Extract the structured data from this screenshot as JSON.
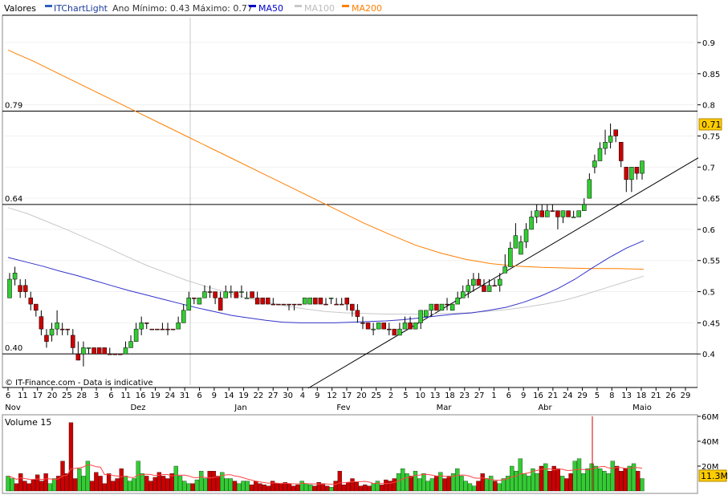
{
  "header": {
    "title": "Valores",
    "ticker": "ITChartLight",
    "range_text": "Ano Mínimo: 0.43 Máximo: 0.77",
    "legend": [
      {
        "label": "MA50",
        "color": "#0000cc"
      },
      {
        "label": "MA100",
        "color": "#c8c8c8"
      },
      {
        "label": "MA200",
        "color": "#ff7f00"
      }
    ]
  },
  "watermark": "© IT-Finance.com - Data is indicative",
  "levels": [
    {
      "value": 0.79,
      "label": "0.79"
    },
    {
      "value": 0.64,
      "label": "0.64"
    },
    {
      "value": 0.4,
      "label": "0.40"
    }
  ],
  "last_price": {
    "label": "0.71",
    "color": "#ffcc00"
  },
  "volume_panel": {
    "title": "Volume 15",
    "last_label": "11.3M",
    "ylim": [
      0,
      60
    ],
    "yticks": [
      {
        "value": 20,
        "label": "20M"
      },
      {
        "value": 40,
        "label": "40M"
      },
      {
        "value": 60,
        "label": "60M"
      }
    ]
  },
  "chart_data": {
    "type": "candlestick",
    "ylim": [
      0.35,
      0.94
    ],
    "yticks": [
      "0.4",
      "0.45",
      "0.5",
      "0.55",
      "0.6",
      "0.65",
      "0.7",
      "0.75",
      "0.8",
      "0.85",
      "0.9"
    ],
    "ytick_values": [
      0.4,
      0.45,
      0.5,
      0.55,
      0.6,
      0.65,
      0.7,
      0.75,
      0.8,
      0.85,
      0.9
    ],
    "xticks": [
      "6",
      "11",
      "17",
      "20",
      "25",
      "28",
      "3",
      "6",
      "11",
      "16",
      "19",
      "24",
      "31",
      "6",
      "9",
      "14",
      "19",
      "22",
      "27",
      "30",
      "4",
      "9",
      "12",
      "17",
      "20",
      "25",
      "2",
      "5",
      "10",
      "13",
      "18",
      "23",
      "27",
      "1",
      "6",
      "9",
      "16",
      "21",
      "24",
      "29",
      "5",
      "8",
      "13",
      "18",
      "21",
      "26",
      "29"
    ],
    "months": [
      "Nov",
      "Dez",
      "Jan",
      "Fev",
      "Mar",
      "Abr",
      "Maio"
    ],
    "candles": [
      [
        0.49,
        0.52,
        0.53,
        0.49,
        "up"
      ],
      [
        0.52,
        0.53,
        0.54,
        0.51,
        "up"
      ],
      [
        0.51,
        0.5,
        0.52,
        0.49,
        "down"
      ],
      [
        0.51,
        0.5,
        0.52,
        0.49,
        "down"
      ],
      [
        0.49,
        0.48,
        0.5,
        0.47,
        "down"
      ],
      [
        0.48,
        0.47,
        0.48,
        0.46,
        "down"
      ],
      [
        0.46,
        0.44,
        0.47,
        0.43,
        "down"
      ],
      [
        0.43,
        0.42,
        0.44,
        0.41,
        "down"
      ],
      [
        0.43,
        0.44,
        0.45,
        0.42,
        "up"
      ],
      [
        0.44,
        0.45,
        0.47,
        0.43,
        "up"
      ],
      [
        0.44,
        0.44,
        0.45,
        0.43,
        "down"
      ],
      [
        0.44,
        0.44,
        0.44,
        0.43,
        "down"
      ],
      [
        0.43,
        0.41,
        0.44,
        0.4,
        "down"
      ],
      [
        0.4,
        0.39,
        0.42,
        0.39,
        "down"
      ],
      [
        0.4,
        0.41,
        0.42,
        0.38,
        "up"
      ],
      [
        0.41,
        0.41,
        0.41,
        0.4,
        "up"
      ],
      [
        0.41,
        0.4,
        0.41,
        0.4,
        "down"
      ],
      [
        0.41,
        0.4,
        0.41,
        0.4,
        "down"
      ],
      [
        0.41,
        0.4,
        0.41,
        0.4,
        "down"
      ],
      [
        0.4,
        0.4,
        0.41,
        0.4,
        "down"
      ],
      [
        0.4,
        0.4,
        0.4,
        0.4,
        "down"
      ],
      [
        0.4,
        0.4,
        0.4,
        0.4,
        "down"
      ],
      [
        0.4,
        0.41,
        0.42,
        0.4,
        "up"
      ],
      [
        0.41,
        0.42,
        0.43,
        0.41,
        "up"
      ],
      [
        0.42,
        0.44,
        0.45,
        0.42,
        "up"
      ],
      [
        0.44,
        0.45,
        0.46,
        0.43,
        "up"
      ],
      [
        0.45,
        0.45,
        0.45,
        0.44,
        "down"
      ],
      [
        0.44,
        0.44,
        0.44,
        0.44,
        "down"
      ],
      [
        0.44,
        0.44,
        0.44,
        0.44,
        "down"
      ],
      [
        0.44,
        0.44,
        0.45,
        0.44,
        "down"
      ],
      [
        0.44,
        0.44,
        0.45,
        0.43,
        "down"
      ],
      [
        0.44,
        0.44,
        0.44,
        0.44,
        "down"
      ],
      [
        0.44,
        0.45,
        0.46,
        0.44,
        "up"
      ],
      [
        0.45,
        0.47,
        0.48,
        0.45,
        "up"
      ],
      [
        0.47,
        0.49,
        0.5,
        0.47,
        "up"
      ],
      [
        0.49,
        0.49,
        0.49,
        0.48,
        "down"
      ],
      [
        0.48,
        0.49,
        0.49,
        0.48,
        "up"
      ],
      [
        0.49,
        0.5,
        0.51,
        0.49,
        "up"
      ],
      [
        0.5,
        0.5,
        0.51,
        0.49,
        "down"
      ],
      [
        0.5,
        0.49,
        0.5,
        0.48,
        "down"
      ],
      [
        0.49,
        0.47,
        0.5,
        0.47,
        "down"
      ],
      [
        0.49,
        0.5,
        0.51,
        0.49,
        "up"
      ],
      [
        0.5,
        0.5,
        0.51,
        0.49,
        "up"
      ],
      [
        0.5,
        0.49,
        0.5,
        0.49,
        "down"
      ],
      [
        0.5,
        0.5,
        0.51,
        0.49,
        "up"
      ],
      [
        0.49,
        0.49,
        0.5,
        0.49,
        "up"
      ],
      [
        0.5,
        0.49,
        0.5,
        0.49,
        "down"
      ],
      [
        0.49,
        0.48,
        0.5,
        0.48,
        "down"
      ],
      [
        0.49,
        0.48,
        0.49,
        0.48,
        "down"
      ],
      [
        0.49,
        0.48,
        0.49,
        0.48,
        "down"
      ],
      [
        0.48,
        0.48,
        0.49,
        0.48,
        "down"
      ],
      [
        0.48,
        0.48,
        0.48,
        0.48,
        "down"
      ],
      [
        0.48,
        0.48,
        0.48,
        0.48,
        "down"
      ],
      [
        0.48,
        0.48,
        0.48,
        0.47,
        "down"
      ],
      [
        0.48,
        0.48,
        0.48,
        0.47,
        "down"
      ],
      [
        0.48,
        0.48,
        0.48,
        0.48,
        "down"
      ],
      [
        0.48,
        0.49,
        0.49,
        0.48,
        "up"
      ],
      [
        0.48,
        0.49,
        0.49,
        0.48,
        "up"
      ],
      [
        0.49,
        0.48,
        0.49,
        0.48,
        "down"
      ],
      [
        0.49,
        0.48,
        0.49,
        0.48,
        "down"
      ],
      [
        0.48,
        0.48,
        0.49,
        0.48,
        "down"
      ],
      [
        0.49,
        0.49,
        0.49,
        0.48,
        "up"
      ],
      [
        0.48,
        0.48,
        0.49,
        0.48,
        "down"
      ],
      [
        0.48,
        0.48,
        0.49,
        0.48,
        "down"
      ],
      [
        0.49,
        0.48,
        0.49,
        0.47,
        "down"
      ],
      [
        0.48,
        0.47,
        0.48,
        0.46,
        "down"
      ],
      [
        0.47,
        0.46,
        0.48,
        0.45,
        "down"
      ],
      [
        0.45,
        0.45,
        0.46,
        0.44,
        "down"
      ],
      [
        0.45,
        0.44,
        0.45,
        0.44,
        "down"
      ],
      [
        0.44,
        0.44,
        0.45,
        0.43,
        "up"
      ],
      [
        0.44,
        0.45,
        0.45,
        0.44,
        "up"
      ],
      [
        0.45,
        0.44,
        0.45,
        0.44,
        "down"
      ],
      [
        0.44,
        0.44,
        0.45,
        0.43,
        "down"
      ],
      [
        0.44,
        0.43,
        0.44,
        0.43,
        "down"
      ],
      [
        0.43,
        0.44,
        0.45,
        0.43,
        "up"
      ],
      [
        0.44,
        0.45,
        0.46,
        0.44,
        "up"
      ],
      [
        0.45,
        0.44,
        0.46,
        0.44,
        "down"
      ],
      [
        0.44,
        0.45,
        0.45,
        0.44,
        "up"
      ],
      [
        0.45,
        0.47,
        0.47,
        0.44,
        "up"
      ],
      [
        0.46,
        0.47,
        0.47,
        0.46,
        "up"
      ],
      [
        0.47,
        0.48,
        0.48,
        0.46,
        "up"
      ],
      [
        0.48,
        0.47,
        0.48,
        0.47,
        "down"
      ],
      [
        0.47,
        0.48,
        0.48,
        0.47,
        "up"
      ],
      [
        0.48,
        0.48,
        0.49,
        0.47,
        "down"
      ],
      [
        0.47,
        0.48,
        0.48,
        0.47,
        "up"
      ],
      [
        0.48,
        0.49,
        0.5,
        0.48,
        "up"
      ],
      [
        0.49,
        0.5,
        0.51,
        0.49,
        "up"
      ],
      [
        0.5,
        0.51,
        0.52,
        0.49,
        "up"
      ],
      [
        0.51,
        0.52,
        0.53,
        0.5,
        "up"
      ],
      [
        0.52,
        0.51,
        0.53,
        0.51,
        "down"
      ],
      [
        0.51,
        0.5,
        0.52,
        0.5,
        "down"
      ],
      [
        0.5,
        0.51,
        0.52,
        0.5,
        "up"
      ],
      [
        0.51,
        0.51,
        0.52,
        0.51,
        "down"
      ],
      [
        0.51,
        0.52,
        0.53,
        0.5,
        "up"
      ],
      [
        0.53,
        0.54,
        0.56,
        0.53,
        "up"
      ],
      [
        0.54,
        0.57,
        0.58,
        0.54,
        "up"
      ],
      [
        0.57,
        0.59,
        0.61,
        0.57,
        "up"
      ],
      [
        0.56,
        0.58,
        0.59,
        0.56,
        "up"
      ],
      [
        0.58,
        0.6,
        0.61,
        0.57,
        "up"
      ],
      [
        0.6,
        0.62,
        0.63,
        0.6,
        "up"
      ],
      [
        0.62,
        0.63,
        0.64,
        0.61,
        "up"
      ],
      [
        0.63,
        0.62,
        0.64,
        0.62,
        "down"
      ],
      [
        0.62,
        0.63,
        0.64,
        0.62,
        "up"
      ],
      [
        0.63,
        0.63,
        0.64,
        0.63,
        "down"
      ],
      [
        0.63,
        0.62,
        0.63,
        0.6,
        "down"
      ],
      [
        0.62,
        0.63,
        0.63,
        0.61,
        "up"
      ],
      [
        0.63,
        0.62,
        0.63,
        0.62,
        "down"
      ],
      [
        0.62,
        0.62,
        0.63,
        0.62,
        "up"
      ],
      [
        0.62,
        0.63,
        0.63,
        0.62,
        "up"
      ],
      [
        0.63,
        0.64,
        0.65,
        0.63,
        "up"
      ],
      [
        0.65,
        0.68,
        0.69,
        0.65,
        "up"
      ],
      [
        0.7,
        0.71,
        0.72,
        0.69,
        "up"
      ],
      [
        0.71,
        0.73,
        0.74,
        0.71,
        "up"
      ],
      [
        0.73,
        0.74,
        0.76,
        0.72,
        "up"
      ],
      [
        0.74,
        0.75,
        0.77,
        0.73,
        "up"
      ],
      [
        0.76,
        0.75,
        0.76,
        0.74,
        "down"
      ],
      [
        0.74,
        0.71,
        0.74,
        0.7,
        "down"
      ],
      [
        0.7,
        0.68,
        0.7,
        0.66,
        "down"
      ],
      [
        0.68,
        0.7,
        0.7,
        0.66,
        "up"
      ],
      [
        0.7,
        0.69,
        0.7,
        0.68,
        "down"
      ],
      [
        0.69,
        0.71,
        0.71,
        0.68,
        "up"
      ]
    ],
    "ma50": [
      0.555,
      0.548,
      0.541,
      0.533,
      0.526,
      0.518,
      0.51,
      0.502,
      0.495,
      0.488,
      0.481,
      0.474,
      0.468,
      0.462,
      0.458,
      0.454,
      0.451,
      0.45,
      0.45,
      0.45,
      0.451,
      0.452,
      0.453,
      0.455,
      0.458,
      0.461,
      0.464,
      0.466,
      0.47,
      0.475,
      0.483,
      0.493,
      0.505,
      0.52,
      0.538,
      0.555,
      0.57,
      0.582
    ],
    "ma100": [
      0.635,
      0.625,
      0.612,
      0.599,
      0.585,
      0.571,
      0.556,
      0.542,
      0.53,
      0.518,
      0.508,
      0.499,
      0.49,
      0.483,
      0.477,
      0.472,
      0.468,
      0.466,
      0.465,
      0.464,
      0.464,
      0.464,
      0.465,
      0.466,
      0.468,
      0.471,
      0.475,
      0.48,
      0.486,
      0.495,
      0.505,
      0.515,
      0.525
    ],
    "ma200": [
      0.888,
      0.87,
      0.85,
      0.83,
      0.81,
      0.79,
      0.77,
      0.75,
      0.73,
      0.71,
      0.69,
      0.67,
      0.65,
      0.63,
      0.61,
      0.592,
      0.575,
      0.562,
      0.552,
      0.545,
      0.541,
      0.539,
      0.538,
      0.537,
      0.537,
      0.536
    ],
    "trendline": [
      [
        0.345,
        384
      ],
      [
        0.715,
        870
      ]
    ],
    "volume_panel_series": {
      "name": "Volume 15",
      "values": [
        12,
        10,
        6,
        14,
        8,
        6,
        9,
        13,
        8,
        14,
        6,
        10,
        12,
        24,
        14,
        55,
        10,
        18,
        12,
        24,
        8,
        15,
        12,
        6,
        14,
        8,
        10,
        18,
        12,
        8,
        10,
        24,
        14,
        12,
        8,
        11,
        15,
        12,
        10,
        14,
        20,
        12,
        8,
        6,
        6,
        9,
        16,
        10,
        16,
        16,
        12,
        15,
        10,
        10,
        8,
        6,
        8,
        8,
        5,
        8,
        6,
        5,
        4,
        8,
        6,
        6,
        7,
        6,
        4,
        5,
        8,
        6,
        5,
        4,
        7,
        6,
        4,
        3,
        8,
        16,
        5,
        7,
        10,
        7,
        4,
        5,
        4,
        6,
        8,
        5,
        9,
        8,
        10,
        14,
        18,
        14,
        12,
        16,
        10,
        14,
        8,
        10,
        12,
        15,
        10,
        12,
        14,
        18,
        12,
        8,
        6,
        4,
        8,
        14,
        10,
        12,
        8,
        6,
        10,
        12,
        20,
        16,
        26,
        14,
        12,
        18,
        14,
        20,
        22,
        16,
        20,
        18,
        12,
        10,
        14,
        24,
        26,
        14,
        18,
        22,
        20,
        18,
        16,
        14,
        24,
        20,
        16,
        18,
        20,
        22,
        16,
        10
      ]
    }
  }
}
